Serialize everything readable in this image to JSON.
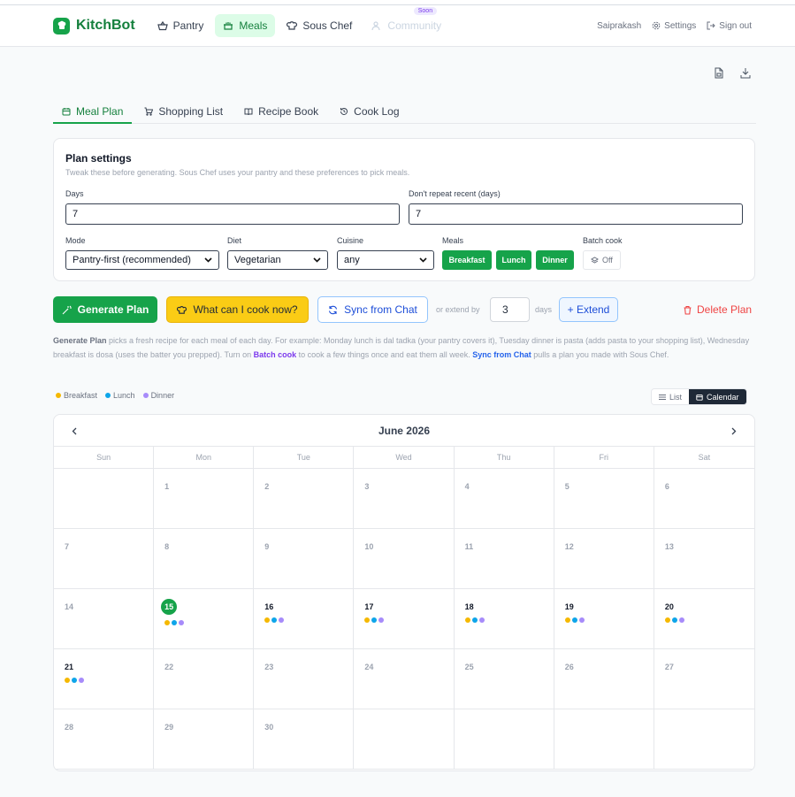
{
  "app": {
    "name": "KitchBot"
  },
  "nav": [
    {
      "label": "Pantry",
      "icon": "basket-icon",
      "state": "normal"
    },
    {
      "label": "Meals",
      "icon": "pot-icon",
      "state": "active"
    },
    {
      "label": "Sous Chef",
      "icon": "chef-hat-icon",
      "state": "normal"
    },
    {
      "label": "Community",
      "icon": "users-icon",
      "state": "disabled",
      "badge": "Soon"
    }
  ],
  "header_right": {
    "user": "Saiprakash",
    "settings": "Settings",
    "signout": "Sign out"
  },
  "tabs": [
    {
      "label": "Meal Plan",
      "icon": "calendar-icon",
      "active": true
    },
    {
      "label": "Shopping List",
      "icon": "cart-icon",
      "active": false
    },
    {
      "label": "Recipe Book",
      "icon": "book-icon",
      "active": false
    },
    {
      "label": "Cook Log",
      "icon": "history-icon",
      "active": false
    }
  ],
  "settings": {
    "title": "Plan settings",
    "subtitle": "Tweak these before generating. Sous Chef uses your pantry and these preferences to pick meals.",
    "days_label": "Days",
    "days_value": "7",
    "norepeat_label": "Don't repeat recent (days)",
    "norepeat_value": "7",
    "mode_label": "Mode",
    "mode_value": "Pantry-first (recommended)",
    "diet_label": "Diet",
    "diet_value": "Vegetarian",
    "cuisine_label": "Cuisine",
    "cuisine_value": "any",
    "meals_label": "Meals",
    "meals": [
      "Breakfast",
      "Lunch",
      "Dinner"
    ],
    "batch_label": "Batch cook",
    "batch_value": "Off"
  },
  "actions": {
    "generate": "Generate Plan",
    "what_can_i_cook": "What can I cook now?",
    "sync": "Sync from Chat",
    "extend_prefix": "or extend by",
    "extend_value": "3",
    "extend_suffix": "days",
    "extend_btn": "+ Extend",
    "delete": "Delete Plan"
  },
  "description": {
    "p1_bold": "Generate Plan",
    "p1": " picks a fresh recipe for each meal of each day. For example: Monday lunch is dal tadka (your pantry covers it), Tuesday dinner is pasta (adds pasta to your shopping list), Wednesday breakfast is dosa (uses the batter you prepped). Turn on ",
    "batch": "Batch cook",
    "p2": " to cook a few things once and eat them all week. ",
    "sync": "Sync from Chat",
    "p3": " pulls a plan you made with Sous Chef."
  },
  "legend": [
    {
      "label": "Breakfast",
      "color": "#f5b800"
    },
    {
      "label": "Lunch",
      "color": "#0ea5e9"
    },
    {
      "label": "Dinner",
      "color": "#a78bfa"
    }
  ],
  "view_toggle": {
    "list": "List",
    "calendar": "Calendar",
    "selected": "calendar"
  },
  "calendar": {
    "month": "June 2026",
    "weekdays": [
      "Sun",
      "Mon",
      "Tue",
      "Wed",
      "Thu",
      "Fri",
      "Sat"
    ],
    "first_weekday_index": 1,
    "days_in_month": 30,
    "today": 15,
    "planned_days": [
      15,
      16,
      17,
      18,
      19,
      20,
      21
    ]
  },
  "colors": {
    "accent": "#16a34a",
    "danger": "#ef4444",
    "link": "#1d4ed8"
  }
}
